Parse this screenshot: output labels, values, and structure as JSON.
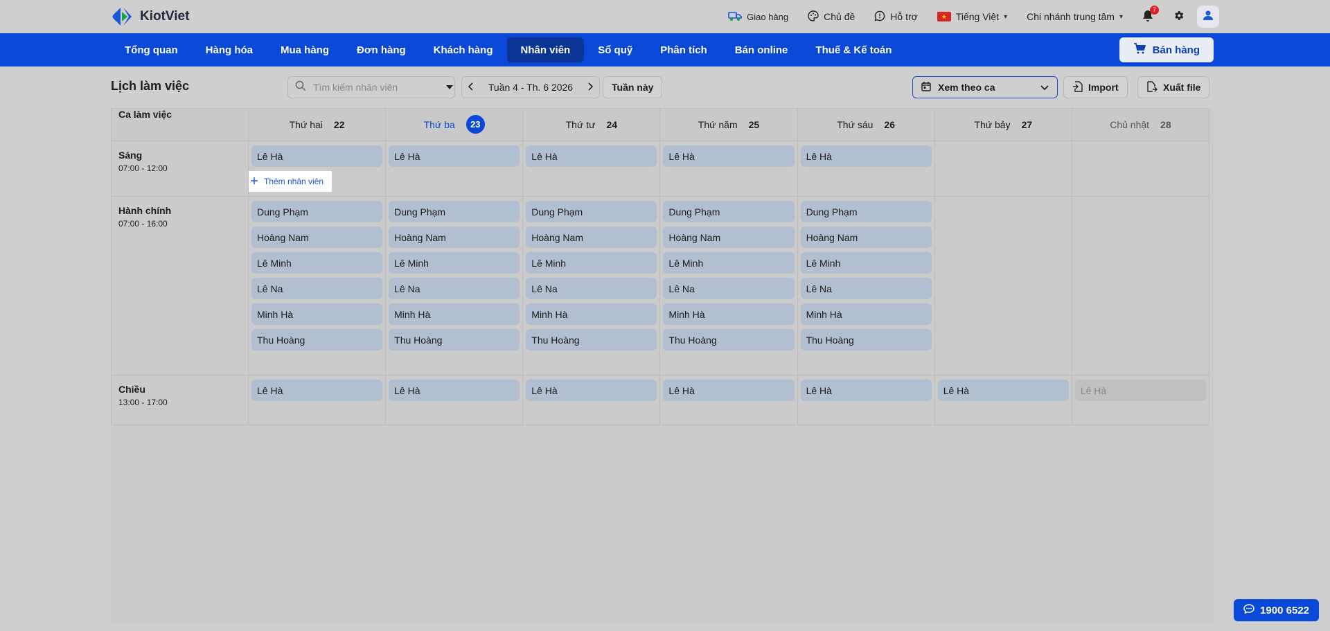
{
  "brand": {
    "name": "KiotViet"
  },
  "topbar": {
    "delivery": "Giao hàng",
    "theme": "Chủ đề",
    "support": "Hỗ trợ",
    "language": "Tiếng Việt",
    "branch": "Chi nhánh trung tâm",
    "notification_count": "7"
  },
  "nav": {
    "items": [
      {
        "label": "Tổng quan"
      },
      {
        "label": "Hàng hóa"
      },
      {
        "label": "Mua hàng"
      },
      {
        "label": "Đơn hàng"
      },
      {
        "label": "Khách hàng"
      },
      {
        "label": "Nhân viên",
        "active": true
      },
      {
        "label": "Sổ quỹ"
      },
      {
        "label": "Phân tích"
      },
      {
        "label": "Bán online"
      },
      {
        "label": "Thuế & Kế toán"
      }
    ],
    "sell_label": "Bán hàng"
  },
  "toolbar": {
    "title": "Lịch làm việc",
    "search_placeholder": "Tìm kiếm nhân viên",
    "week_label": "Tuần 4 - Th. 6 2026",
    "this_week": "Tuần này",
    "view_mode": "Xem theo ca",
    "import_label": "Import",
    "export_label": "Xuất file"
  },
  "schedule": {
    "corner_label": "Ca làm việc",
    "days": [
      {
        "name": "Thứ hai",
        "num": "22"
      },
      {
        "name": "Thứ ba",
        "num": "23",
        "today": true
      },
      {
        "name": "Thứ tư",
        "num": "24"
      },
      {
        "name": "Thứ năm",
        "num": "25"
      },
      {
        "name": "Thứ sáu",
        "num": "26"
      },
      {
        "name": "Thứ bảy",
        "num": "27"
      },
      {
        "name": "Chủ nhật",
        "num": "28"
      }
    ],
    "add_employee_label": "Thêm nhân viên",
    "shifts": [
      {
        "name": "Sáng",
        "time": "07:00 - 12:00",
        "cells": [
          [
            "Lê Hà"
          ],
          [
            "Lê Hà"
          ],
          [
            "Lê Hà"
          ],
          [
            "Lê Hà"
          ],
          [
            "Lê Hà"
          ],
          [],
          []
        ]
      },
      {
        "name": "Hành chính",
        "time": "07:00 - 16:00",
        "cells": [
          [
            "Dung Phạm",
            "Hoàng Nam",
            "Lê Minh",
            "Lê Na",
            "Minh Hà",
            "Thu Hoàng"
          ],
          [
            "Dung Phạm",
            "Hoàng Nam",
            "Lê Minh",
            "Lê Na",
            "Minh Hà",
            "Thu Hoàng"
          ],
          [
            "Dung Phạm",
            "Hoàng Nam",
            "Lê Minh",
            "Lê Na",
            "Minh Hà",
            "Thu Hoàng"
          ],
          [
            "Dung Phạm",
            "Hoàng Nam",
            "Lê Minh",
            "Lê Na",
            "Minh Hà",
            "Thu Hoàng"
          ],
          [
            "Dung Phạm",
            "Hoàng Nam",
            "Lê Minh",
            "Lê Na",
            "Minh Hà",
            "Thu Hoàng"
          ],
          [],
          []
        ]
      },
      {
        "name": "Chiều",
        "time": "13:00 - 17:00",
        "cells": [
          [
            "Lê Hà"
          ],
          [
            "Lê Hà"
          ],
          [
            "Lê Hà"
          ],
          [
            "Lê Hà"
          ],
          [
            "Lê Hà"
          ],
          [
            "Lê Hà"
          ],
          [
            "Lê Hà"
          ]
        ],
        "muted_days": [
          6
        ]
      }
    ]
  },
  "hotline": "1900 6522",
  "colors": {
    "primary": "#0a48d8",
    "nav_active": "#0a3596",
    "chip": "#b2bfd0"
  }
}
